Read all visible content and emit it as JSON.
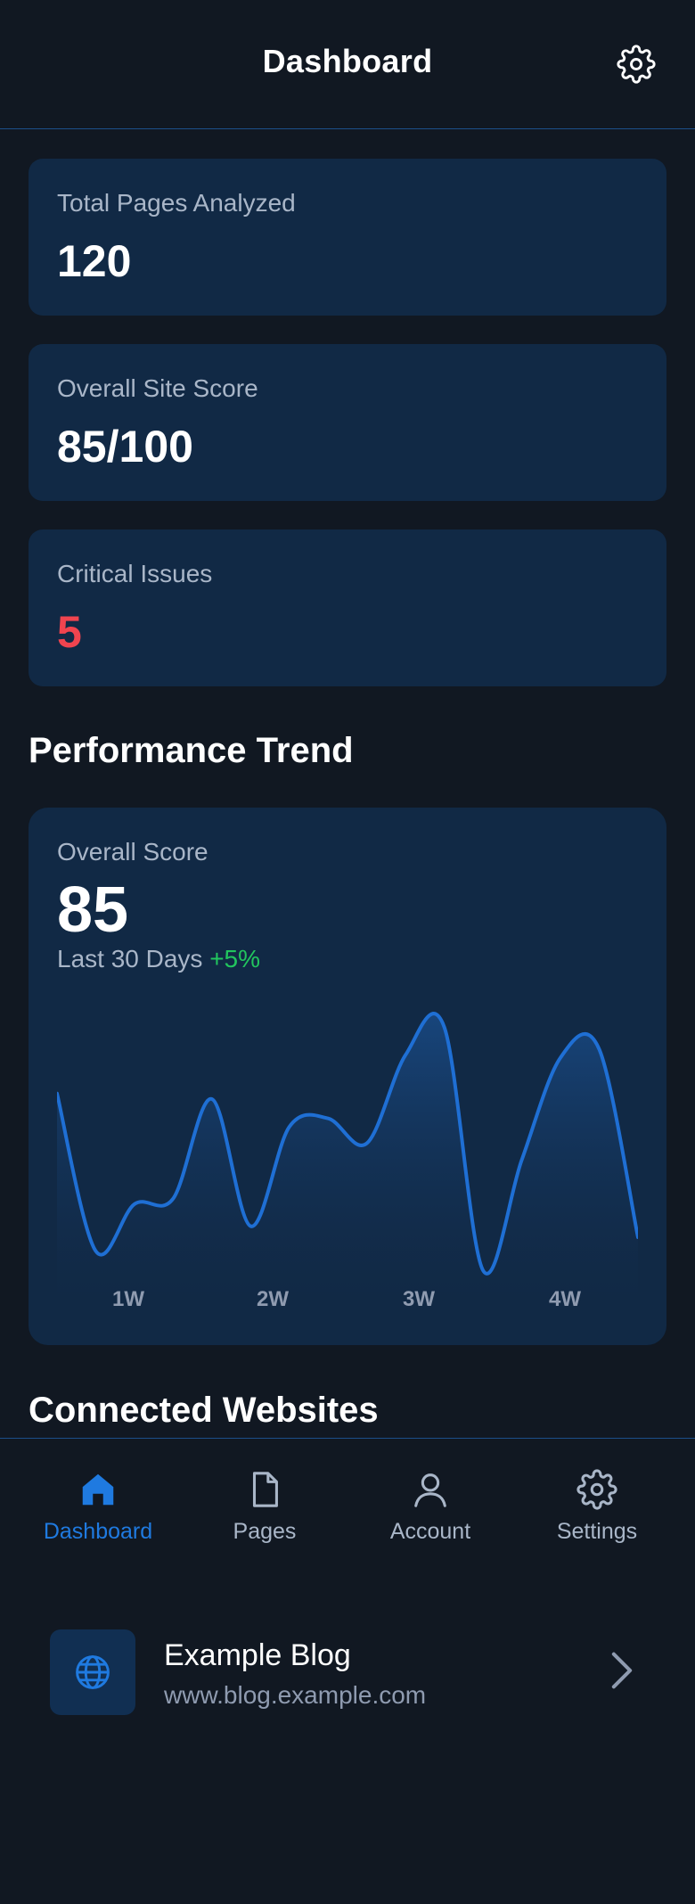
{
  "header": {
    "title": "Dashboard",
    "settings_icon": "gear-icon"
  },
  "stats": [
    {
      "label": "Total Pages Analyzed",
      "value": "120"
    },
    {
      "label": "Overall Site Score",
      "value": "85/100"
    },
    {
      "label": "Critical Issues",
      "value": "5",
      "value_color": "#f0444f"
    }
  ],
  "performance": {
    "section_title": "Performance Trend",
    "score_label": "Overall Score",
    "score": "85",
    "period": "Last 30 Days",
    "delta": "+5%",
    "delta_color": "#22c55e"
  },
  "chart_data": {
    "type": "area",
    "x_ticks": [
      "1W",
      "2W",
      "3W",
      "4W"
    ],
    "values": [
      0.72,
      0.15,
      0.32,
      0.34,
      0.7,
      0.24,
      0.6,
      0.63,
      0.54,
      0.86,
      0.96,
      0.08,
      0.48,
      0.85,
      0.88,
      0.2
    ],
    "line_color": "#1f6fd4"
  },
  "connected": {
    "section_title": "Connected Websites",
    "sites": [
      {
        "name": "Example Blog",
        "url": "www.blog.example.com",
        "icon": "globe-icon"
      }
    ]
  },
  "nav": {
    "active_color": "#1f7ae0",
    "items": [
      {
        "label": "Dashboard",
        "icon": "home-icon",
        "active": true
      },
      {
        "label": "Pages",
        "icon": "file-icon",
        "active": false
      },
      {
        "label": "Account",
        "icon": "user-icon",
        "active": false
      },
      {
        "label": "Settings",
        "icon": "gear-icon",
        "active": false
      }
    ]
  }
}
